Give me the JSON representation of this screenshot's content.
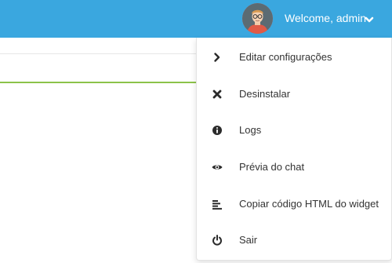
{
  "header": {
    "welcome_text": "Welcome, admin",
    "avatar_icon": "user-avatar-icon",
    "dropdown_icon": "chevron-down-icon",
    "background_color": "#3aa7df"
  },
  "menu": {
    "items": [
      {
        "label": "Editar configurações",
        "icon": "chevron-right-icon"
      },
      {
        "label": "Desinstalar",
        "icon": "close-icon"
      },
      {
        "label": "Logs",
        "icon": "info-icon"
      },
      {
        "label": "Prévia do chat",
        "icon": "eye-icon"
      },
      {
        "label": "Copiar código HTML do widget",
        "icon": "align-left-icon"
      },
      {
        "label": "Sair",
        "icon": "power-icon"
      }
    ]
  },
  "colors": {
    "accent_line": "#8cc34a",
    "text": "#333333",
    "icon": "#2b2b2b"
  }
}
